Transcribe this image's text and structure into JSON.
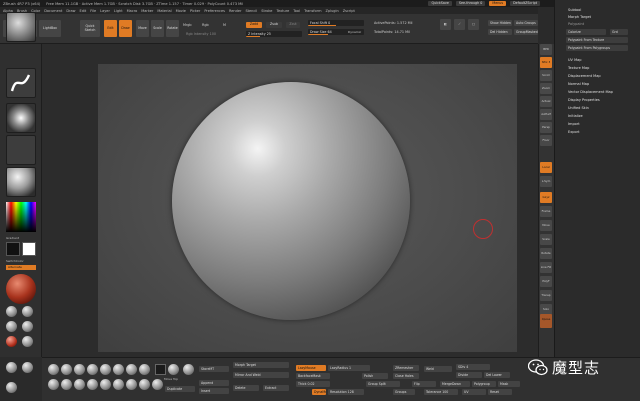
{
  "titlebar": {
    "title": "ZBrush 4R7 P3 (x64)",
    "info": "Free Mem 11.1GB · Active Mem 1.7GB · Scratch Disk 3.7GB · ZTime 1.157 · Timer 0.029 · PolyCount 0.473 Mil",
    "quicksave": "QuickSave",
    "seethrough": "See-through 0",
    "menus": "Menus",
    "defaultscript": "DefaultZScript"
  },
  "menubar": [
    "Alpha",
    "Brush",
    "Color",
    "Document",
    "Draw",
    "Edit",
    "File",
    "Layer",
    "Light",
    "Macro",
    "Marker",
    "Material",
    "Movie",
    "Picker",
    "Preferences",
    "Render",
    "Stencil",
    "Stroke",
    "Texture",
    "Tool",
    "Transform",
    "Zplugin",
    "Zscript"
  ],
  "toolbar": {
    "projection_master": "Projection Master",
    "lightbox": "LightBox",
    "quick_sketch": "Quick Sketch",
    "edit": "Edit",
    "draw": "Draw",
    "move": "Move",
    "scale": "Scale",
    "rotate": "Rotate",
    "mrgb": "Mrgb",
    "rgb": "Rgb",
    "m": "M",
    "zadd": "Zadd",
    "zsub": "Zsub",
    "zcut": "Zcut",
    "z_intensity": "Z Intensity 25",
    "focal_shift": "Focal Shift 0",
    "draw_size": "Draw Size 64",
    "dynamic": "Dynamic",
    "active_points": "ActivePoints: 1.572 Mil",
    "total_points": "TotalPoints: 14.71 Mil",
    "rgb_intensity": "Rgb Intensity 100"
  },
  "right_top": {
    "show_hidden": "Show Hidden",
    "auto_groups": "Auto Groups",
    "del_hidden": "Del Hidden",
    "group_masked": "GroupMasked"
  },
  "right_panel": {
    "items_top": [
      "Subtool",
      "Morph Target"
    ],
    "polypaint": "Polypaint",
    "colorize": "Colorize",
    "grd": "Grd",
    "from_texture": "Polypaint From Texture",
    "from_polygroups": "Polypaint From Polygroups",
    "items": [
      "UV Map",
      "Texture Map",
      "Displacement Map",
      "Normal Map",
      "Vector Displacement Map",
      "Display Properties",
      "Unified Skin",
      "Initialize",
      "Import",
      "Export"
    ]
  },
  "right_shelf": [
    "BPR",
    "SPix 3",
    "Scroll",
    "Zoom",
    "Actual",
    "AAHalf",
    "Persp",
    "Floor",
    "Local",
    "L.Sym",
    "Gxyz",
    "Frame",
    "Move",
    "Scale",
    "Rotate",
    "Line Fill",
    "PolyF",
    "Transp",
    "Solo",
    "Xpose"
  ],
  "left_shelf": {
    "gradient": "Gradient",
    "switch_color": "SwitchColor",
    "alternate": "Alternate",
    "mats": [
      "SkinShade4",
      "MatCap Gray",
      "Basic Material",
      "BasicMat",
      "MatCap Red 01",
      "Chrome",
      "Toy Plastic",
      "Hilite",
      "SkinShade"
    ]
  },
  "bottom": {
    "brushes": [
      "ClayBuildup",
      "Standard",
      "DamStandard",
      "Move",
      "Inflate",
      "Pinch",
      "TrimDynamic",
      "Smooth",
      "hPolish",
      "Move Top",
      "Dynamic"
    ],
    "buttons": {
      "morph_target": "Morph Target",
      "store_mt": "StoreMT",
      "append": "Append",
      "insert": "Insert",
      "duplicate": "Duplicate",
      "delete": "Delete",
      "mirror_weld": "Mirror And Weld",
      "extract": "Extract",
      "subdivision_level": "SDiv 4",
      "divide": "Divide",
      "del_lower": "Del Lower",
      "del_higher": "Del Higher",
      "lazy_mouse": "LazyMouse",
      "lazy_radius": "LazyRadius 1",
      "backfacemask": "BackfaceMask",
      "zremesher": "ZRemesher",
      "thick": "Thick 0.02",
      "dynamesh": "DynaMesh",
      "resolution": "Resolution 128",
      "polish": "Polish",
      "group_split": "Group Split",
      "merge_down": "MergeDown",
      "close_holes": "Close Holes",
      "flip": "Flip",
      "weld": "Weld",
      "groups": "Groups",
      "uv": "UV",
      "polygroup": "Polygroup",
      "mask": "Mask",
      "tolerance": "Tolerance 100",
      "reset": "Reset",
      "mirror": "Mirror"
    }
  },
  "watermark": {
    "text": "魔型志"
  },
  "colors": {
    "accent": "#e07b24",
    "bg": "#2a2a2a",
    "cursor": "#c03030"
  }
}
